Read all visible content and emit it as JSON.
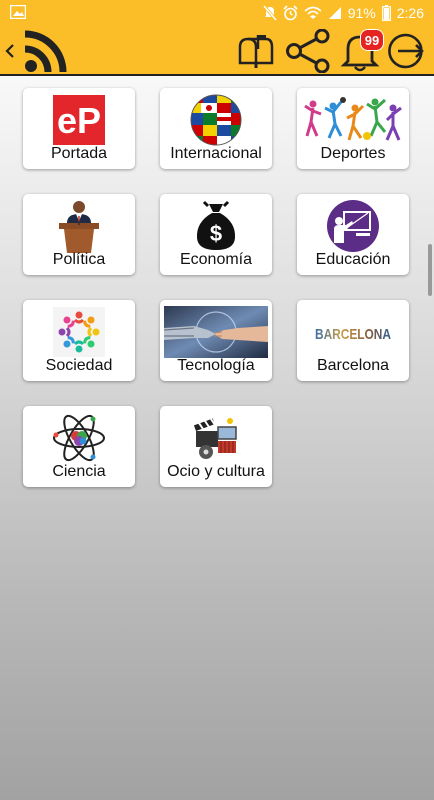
{
  "status_bar": {
    "battery_percent": "91%",
    "time": "2:26",
    "icons": [
      "gallery-icon",
      "mute-icon",
      "alarm-icon",
      "wifi-icon",
      "signal-icon",
      "battery-icon"
    ]
  },
  "app_bar": {
    "icons": [
      "back-icon",
      "rss-icon",
      "mailbox-icon",
      "share-icon",
      "bell-icon",
      "logout-icon"
    ],
    "notification_count": "99",
    "colors": {
      "bar": "#fbbd28",
      "icon": "#222222",
      "badge": "#e52320"
    }
  },
  "categories": [
    {
      "label": "Portada",
      "icon": "ep-logo-icon"
    },
    {
      "label": "Internacional",
      "icon": "flags-globe-icon"
    },
    {
      "label": "Deportes",
      "icon": "athletes-icon"
    },
    {
      "label": "Política",
      "icon": "podium-speaker-icon"
    },
    {
      "label": "Economía",
      "icon": "money-bag-icon"
    },
    {
      "label": "Educación",
      "icon": "teacher-board-icon"
    },
    {
      "label": "Sociedad",
      "icon": "people-circle-icon"
    },
    {
      "label": "Tecnología",
      "icon": "robot-handshake-icon"
    },
    {
      "label": "Barcelona",
      "icon": "barcelona-text-icon"
    },
    {
      "label": "Ciencia",
      "icon": "atom-icon"
    },
    {
      "label": "Ocio y cultura",
      "icon": "film-clapper-icon"
    }
  ],
  "barcelona_logo_text": "BARCELONA",
  "ep_logo_text": "eP",
  "economia_symbol": "$"
}
